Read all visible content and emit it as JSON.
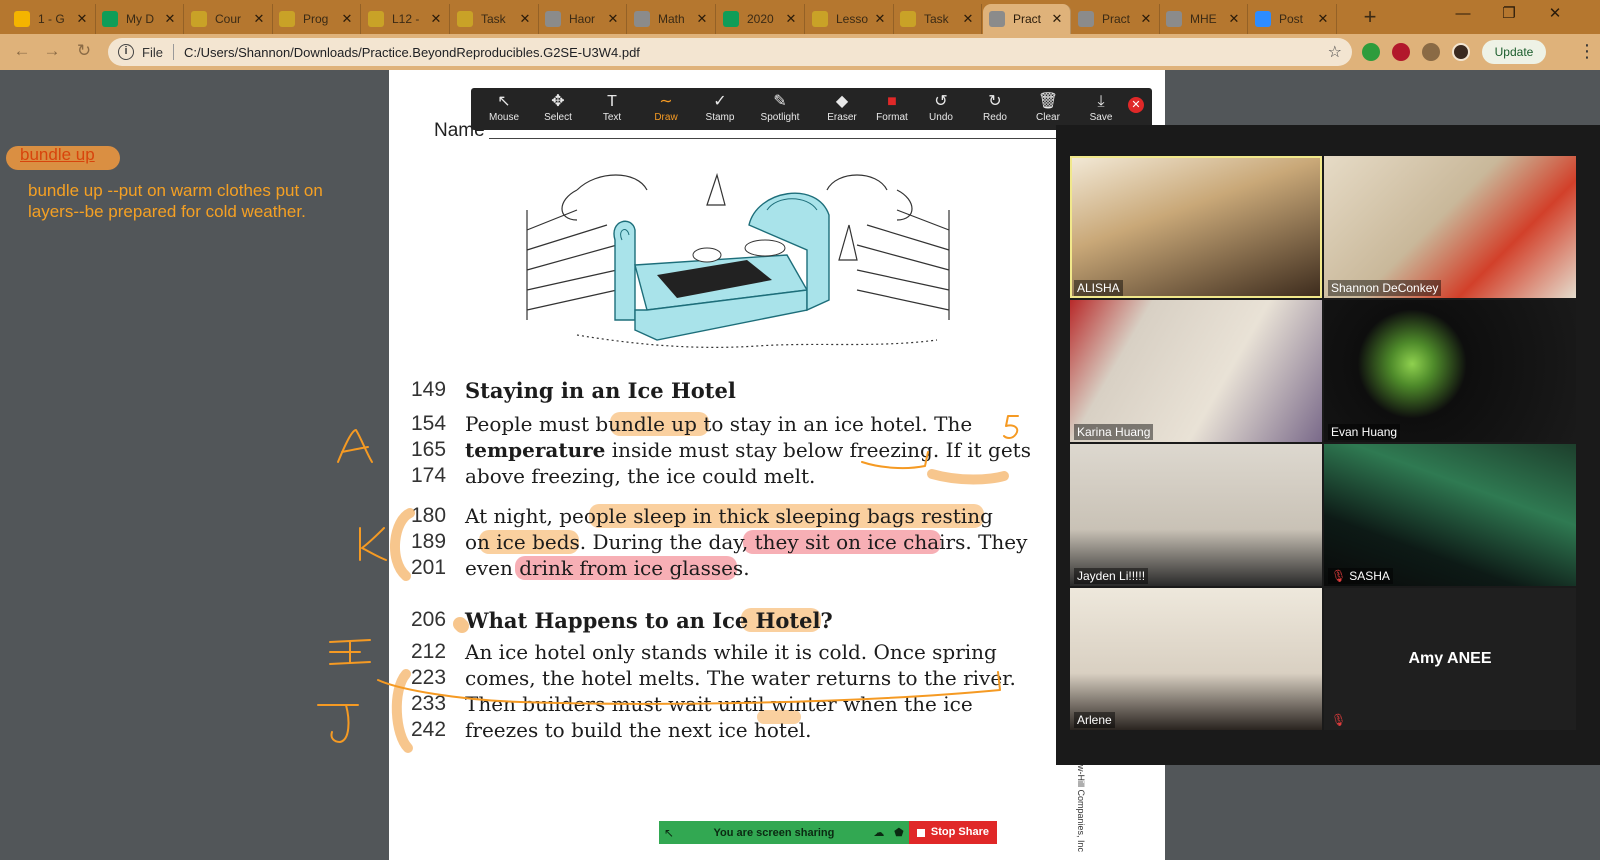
{
  "browser": {
    "tabs": [
      {
        "title": "1 - G",
        "icon": "slides-icon",
        "color": "#f4b400",
        "active": false
      },
      {
        "title": "My D",
        "icon": "drive-icon",
        "color": "#0f9d58",
        "active": false
      },
      {
        "title": "Cour",
        "icon": "classroom-icon",
        "color": "#c9a227",
        "active": false
      },
      {
        "title": "Prog",
        "icon": "classroom-icon",
        "color": "#c9a227",
        "active": false
      },
      {
        "title": "L12 -",
        "icon": "classroom-icon",
        "color": "#c9a227",
        "active": false
      },
      {
        "title": "Task",
        "icon": "classroom-icon",
        "color": "#c9a227",
        "active": false
      },
      {
        "title": "Haor",
        "icon": "globe-icon",
        "color": "#8b8b8b",
        "active": false
      },
      {
        "title": "Math",
        "icon": "globe-icon",
        "color": "#8b8b8b",
        "active": false
      },
      {
        "title": "2020",
        "icon": "sheets-icon",
        "color": "#0f9d58",
        "active": false
      },
      {
        "title": "Lesso",
        "icon": "classroom-icon",
        "color": "#c9a227",
        "active": false
      },
      {
        "title": "Task",
        "icon": "classroom-icon",
        "color": "#c9a227",
        "active": false
      },
      {
        "title": "Pract",
        "icon": "globe-icon",
        "color": "#8b8b8b",
        "active": true
      },
      {
        "title": "Pract",
        "icon": "globe-icon",
        "color": "#8b8b8b",
        "active": false
      },
      {
        "title": "MHE",
        "icon": "globe-icon",
        "color": "#8b8b8b",
        "active": false
      },
      {
        "title": "Post",
        "icon": "zoom-icon",
        "color": "#2d8cff",
        "active": false
      }
    ],
    "address": {
      "scheme_label": "File",
      "url": "C:/Users/Shannon/Downloads/Practice.BeyondReproducibles.G2SE-U3W4.pdf"
    },
    "update_label": "Update"
  },
  "notes": {
    "word": "bundle up",
    "definition": "bundle up --put on warm clothes put on layers--be prepared for cold weather."
  },
  "annotate": {
    "tools": [
      {
        "label": "Mouse",
        "icon": "mouse-pointer-icon",
        "glyph": "↖"
      },
      {
        "label": "Select",
        "icon": "move-icon",
        "glyph": "✥"
      },
      {
        "label": "Text",
        "icon": "text-icon",
        "glyph": "T"
      },
      {
        "label": "Draw",
        "icon": "draw-icon",
        "glyph": "∼",
        "active": true
      },
      {
        "label": "Stamp",
        "icon": "stamp-icon",
        "glyph": "✓"
      },
      {
        "label": "Spotlight",
        "icon": "spotlight-icon",
        "glyph": "✎"
      },
      {
        "label": "Eraser",
        "icon": "eraser-icon",
        "glyph": "◆"
      },
      {
        "label": "Format",
        "icon": "format-icon",
        "glyph": "■",
        "color": "#e02828"
      },
      {
        "label": "Undo",
        "icon": "undo-icon",
        "glyph": "↺"
      },
      {
        "label": "Redo",
        "icon": "redo-icon",
        "glyph": "↻"
      },
      {
        "label": "Clear",
        "icon": "trash-icon",
        "glyph": "🗑"
      },
      {
        "label": "Save",
        "icon": "save-icon",
        "glyph": "⤓"
      }
    ]
  },
  "pdf": {
    "name_label": "Name",
    "lines": [
      {
        "num": "149",
        "text": "Staying in an Ice Hotel",
        "heading": true
      },
      {
        "num": "154",
        "text": "   People must bundle up to stay in an ice hotel. The"
      },
      {
        "num": "165",
        "html_bold": "temperature",
        "text": " inside must stay below freezing. If it gets"
      },
      {
        "num": "174",
        "text": "above freezing, the ice could melt."
      },
      {
        "num": "180",
        "text": "   At night, people sleep in thick sleeping bags resting"
      },
      {
        "num": "189",
        "text": "on ice beds. During the day, they sit on ice chairs. They"
      },
      {
        "num": "201",
        "text": "even drink from ice glasses."
      },
      {
        "num": "206",
        "text": "What Happens to an Ice Hotel?",
        "heading": true
      },
      {
        "num": "212",
        "text": "   An ice hotel only stands while it is cold. Once spring"
      },
      {
        "num": "223",
        "text": "comes, the hotel melts. The water returns to the river."
      },
      {
        "num": "233",
        "text": "Then builders must wait until winter when the ice"
      },
      {
        "num": "242",
        "text": "freezes to build the next ice hotel."
      }
    ],
    "copyright": "aw-Hill Companies, Inc"
  },
  "zoom": {
    "participants": [
      {
        "name": "ALISHA",
        "speaking": true,
        "muted": false
      },
      {
        "name": "Shannon DeConkey",
        "muted": false
      },
      {
        "name": "Karina Huang",
        "muted": false
      },
      {
        "name": "Evan Huang",
        "muted": false
      },
      {
        "name": "Jayden Li!!!!!",
        "muted": false
      },
      {
        "name": "SASHA",
        "muted": true
      },
      {
        "name": "Arlene",
        "muted": false
      },
      {
        "name": "",
        "display": "Amy ANEE",
        "muted": true
      }
    ],
    "sharing": {
      "message": "You are screen sharing",
      "stop_label": "Stop Share"
    }
  }
}
